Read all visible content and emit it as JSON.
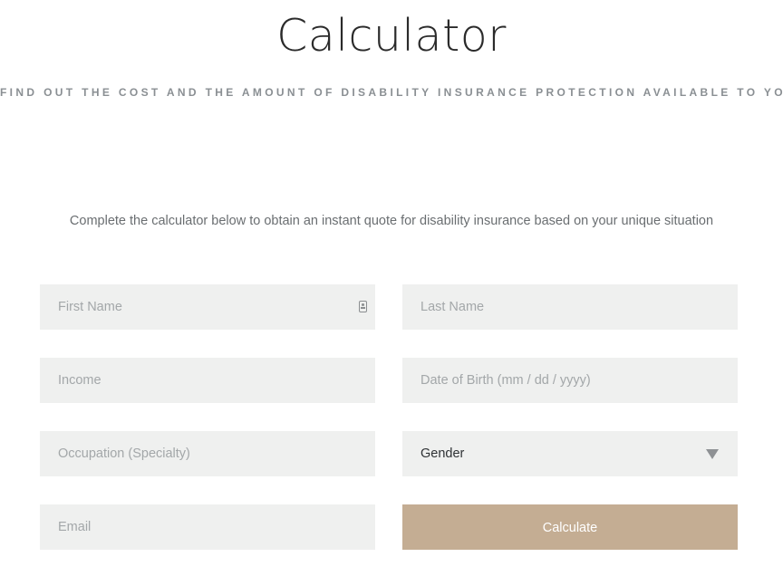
{
  "header": {
    "title": "Calculator",
    "subtitle": "FIND OUT THE COST AND THE AMOUNT OF DISABILITY INSURANCE PROTECTION AVAILABLE TO YOU"
  },
  "intro": "Complete the calculator below to obtain an instant quote for disability insurance based on your unique situation",
  "form": {
    "first_name": {
      "placeholder": "First Name",
      "value": ""
    },
    "last_name": {
      "placeholder": "Last Name",
      "value": ""
    },
    "income": {
      "placeholder": "Income",
      "value": ""
    },
    "dob": {
      "placeholder": "Date of Birth (mm / dd / yyyy)",
      "value": ""
    },
    "occupation": {
      "placeholder": "Occupation (Specialty)",
      "value": ""
    },
    "gender": {
      "selected": "Gender",
      "icon": "chevron-down-icon"
    },
    "email": {
      "placeholder": "Email",
      "value": ""
    },
    "calculate_label": "Calculate"
  },
  "icons": {
    "first_name_autofill": "contact-card-icon"
  },
  "colors": {
    "button_bg": "#c4ad93",
    "field_bg": "#eff0ef",
    "subtitle_text": "#8a8f93"
  }
}
